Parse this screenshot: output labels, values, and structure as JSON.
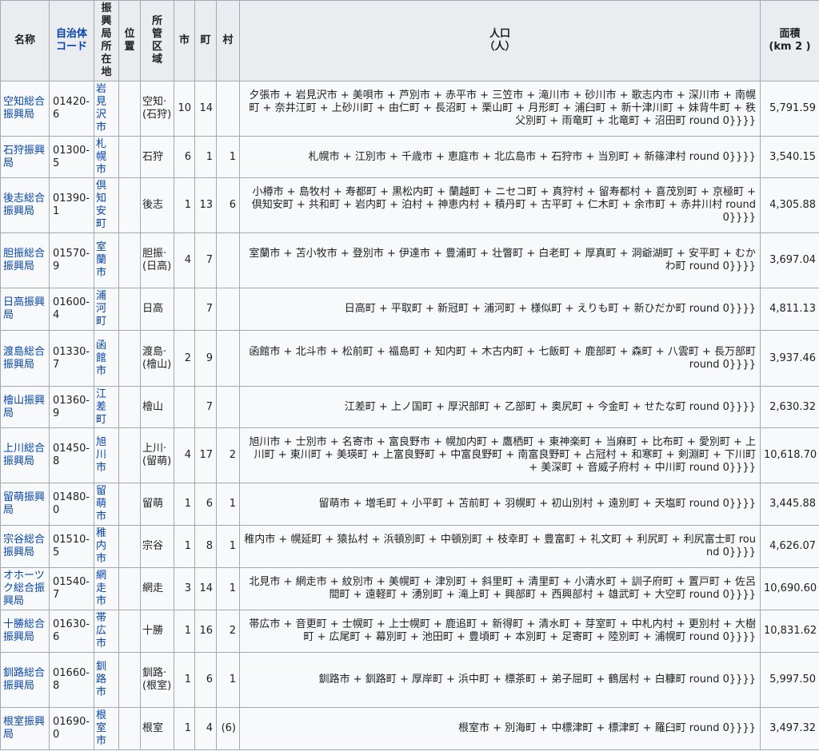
{
  "headers": {
    "name": "名称",
    "code": "自治体コード",
    "office": "振興局所在地",
    "position": "位置",
    "region": "所管区域",
    "city": "市",
    "town": "町",
    "village": "村",
    "population": "人口",
    "population_unit": "（人）",
    "area": "面積",
    "area_unit": "(km 2 )"
  },
  "rows": [
    {
      "name": "空知総合振興局",
      "code": "01420-6",
      "office": "岩見沢市",
      "region": "空知·(石狩)",
      "city": "10",
      "town": "14",
      "village": "",
      "population": "夕張市 + 岩見沢市 + 美唄市 + 芦別市 + 赤平市 + 三笠市 + 滝川市 + 砂川市 + 歌志内市 + 深川市 + 南幌町 + 奈井江町 + 上砂川町 + 由仁町 + 長沼町 + 栗山町 + 月形町 + 浦臼町 + 新十津川町 + 妹背牛町 + 秩父別町 + 雨竜町 + 北竜町 + 沼田町 round 0}}}}",
      "area": "5,791.59"
    },
    {
      "name": "石狩振興局",
      "code": "01300-5",
      "office": "札幌市",
      "region": "石狩",
      "city": "6",
      "town": "1",
      "village": "1",
      "population": "札幌市 + 江別市 + 千歳市 + 恵庭市 + 北広島市 + 石狩市 + 当別町 + 新篠津村 round 0}}}}",
      "area": "3,540.15"
    },
    {
      "name": "後志総合振興局",
      "code": "01390-1",
      "office": "倶知安町",
      "region": "後志",
      "city": "1",
      "town": "13",
      "village": "6",
      "population": "小樽市 + 島牧村 + 寿都町 + 黒松内町 + 蘭越町 + ニセコ町 + 真狩村 + 留寿都村 + 喜茂別町 + 京極町 + 倶知安町 + 共和町 + 岩内町 + 泊村 + 神恵内村 + 積丹町 + 古平町 + 仁木町 + 余市町 + 赤井川村 round 0}}}}",
      "area": "4,305.88"
    },
    {
      "name": "胆振総合振興局",
      "code": "01570-9",
      "office": "室蘭市",
      "region": "胆振·(日高)",
      "city": "4",
      "town": "7",
      "village": "",
      "population": "室蘭市 + 苫小牧市 + 登別市 + 伊達市 + 豊浦町 + 壮瞥町 + 白老町 + 厚真町 + 洞爺湖町 + 安平町 + むかわ町 round 0}}}}",
      "area": "3,697.04"
    },
    {
      "name": "日高振興局",
      "code": "01600-4",
      "office": "浦河町",
      "region": "日高",
      "city": "",
      "town": "7",
      "village": "",
      "population": "日高町 + 平取町 + 新冠町 + 浦河町 + 様似町 + えりも町 + 新ひだか町 round 0}}}}",
      "area": "4,811.13"
    },
    {
      "name": "渡島総合振興局",
      "code": "01330-7",
      "office": "函館市",
      "region": "渡島·(檜山)",
      "city": "2",
      "town": "9",
      "village": "",
      "population": "函館市 + 北斗市 + 松前町 + 福島町 + 知内町 + 木古内町 + 七飯町 + 鹿部町 + 森町 + 八雲町 + 長万部町 round 0}}}}",
      "area": "3,937.46"
    },
    {
      "name": "檜山振興局",
      "code": "01360-9",
      "office": "江差町",
      "region": "檜山",
      "city": "",
      "town": "7",
      "village": "",
      "population": "江差町 + 上ノ国町 + 厚沢部町 + 乙部町 + 奥尻町 + 今金町 + せたな町 round 0}}}}",
      "area": "2,630.32"
    },
    {
      "name": "上川総合振興局",
      "code": "01450-8",
      "office": "旭川市",
      "region": "上川·(留萌)",
      "city": "4",
      "town": "17",
      "village": "2",
      "population": "旭川市 + 士別市 + 名寄市 + 富良野市 + 幌加内町 + 鷹栖町 + 東神楽町 + 当麻町 + 比布町 + 愛別町 + 上川町 + 東川町 + 美瑛町 + 上富良野町 + 中富良野町 + 南富良野町 + 占冠村 + 和寒町 + 剣淵町 + 下川町 + 美深町 + 音威子府村 + 中川町 round 0}}}}",
      "area": "10,618.70"
    },
    {
      "name": "留萌振興局",
      "code": "01480-0",
      "office": "留萌市",
      "region": "留萌",
      "city": "1",
      "town": "6",
      "village": "1",
      "population": "留萌市 + 増毛町 + 小平町 + 苫前町 + 羽幌町 + 初山別村 + 遠別町 + 天塩町 round 0}}}}",
      "area": "3,445.88"
    },
    {
      "name": "宗谷総合振興局",
      "code": "01510-5",
      "office": "稚内市",
      "region": "宗谷",
      "city": "1",
      "town": "8",
      "village": "1",
      "population": "稚内市 + 幌延町 + 猿払村 + 浜頓別町 + 中頓別町 + 枝幸町 + 豊富町 + 礼文町 + 利尻町 + 利尻富士町 round 0}}}}",
      "area": "4,626.07"
    },
    {
      "name": "オホーツク総合振興局",
      "code": "01540-7",
      "office": "網走市",
      "region": "網走",
      "city": "3",
      "town": "14",
      "village": "1",
      "population": "北見市 + 網走市 + 紋別市 + 美幌町 + 津別町 + 斜里町 + 清里町 + 小清水町 + 訓子府町 + 置戸町 + 佐呂間町 + 遠軽町 + 湧別町 + 滝上町 + 興部町 + 西興部村 + 雄武町 + 大空町 round 0}}}}",
      "area": "10,690.60"
    },
    {
      "name": "十勝総合振興局",
      "code": "01630-6",
      "office": "帯広市",
      "region": "十勝",
      "city": "1",
      "town": "16",
      "village": "2",
      "population": "帯広市 + 音更町 + 士幌町 + 上士幌町 + 鹿追町 + 新得町 + 清水町 + 芽室町 + 中札内村 + 更別村 + 大樹町 + 広尾町 + 幕別町 + 池田町 + 豊頃町 + 本別町 + 足寄町 + 陸別町 + 浦幌町 round 0}}}}",
      "area": "10,831.62"
    },
    {
      "name": "釧路総合振興局",
      "code": "01660-8",
      "office": "釧路市",
      "region": "釧路·(根室)",
      "city": "1",
      "town": "6",
      "village": "1",
      "population": "釧路市 + 釧路町 + 厚岸町 + 浜中町 + 標茶町 + 弟子屈町 + 鶴居村 + 白糠町 round 0}}}}",
      "area": "5,997.50"
    },
    {
      "name": "根室振興局",
      "code": "01690-0",
      "office": "根室市",
      "region": "根室",
      "city": "1",
      "town": "4",
      "village": "(6)",
      "population": "根室市 + 別海町 + 中標津町 + 標津町 + 羅臼町 round 0}}}}",
      "area": "3,497.32"
    }
  ]
}
